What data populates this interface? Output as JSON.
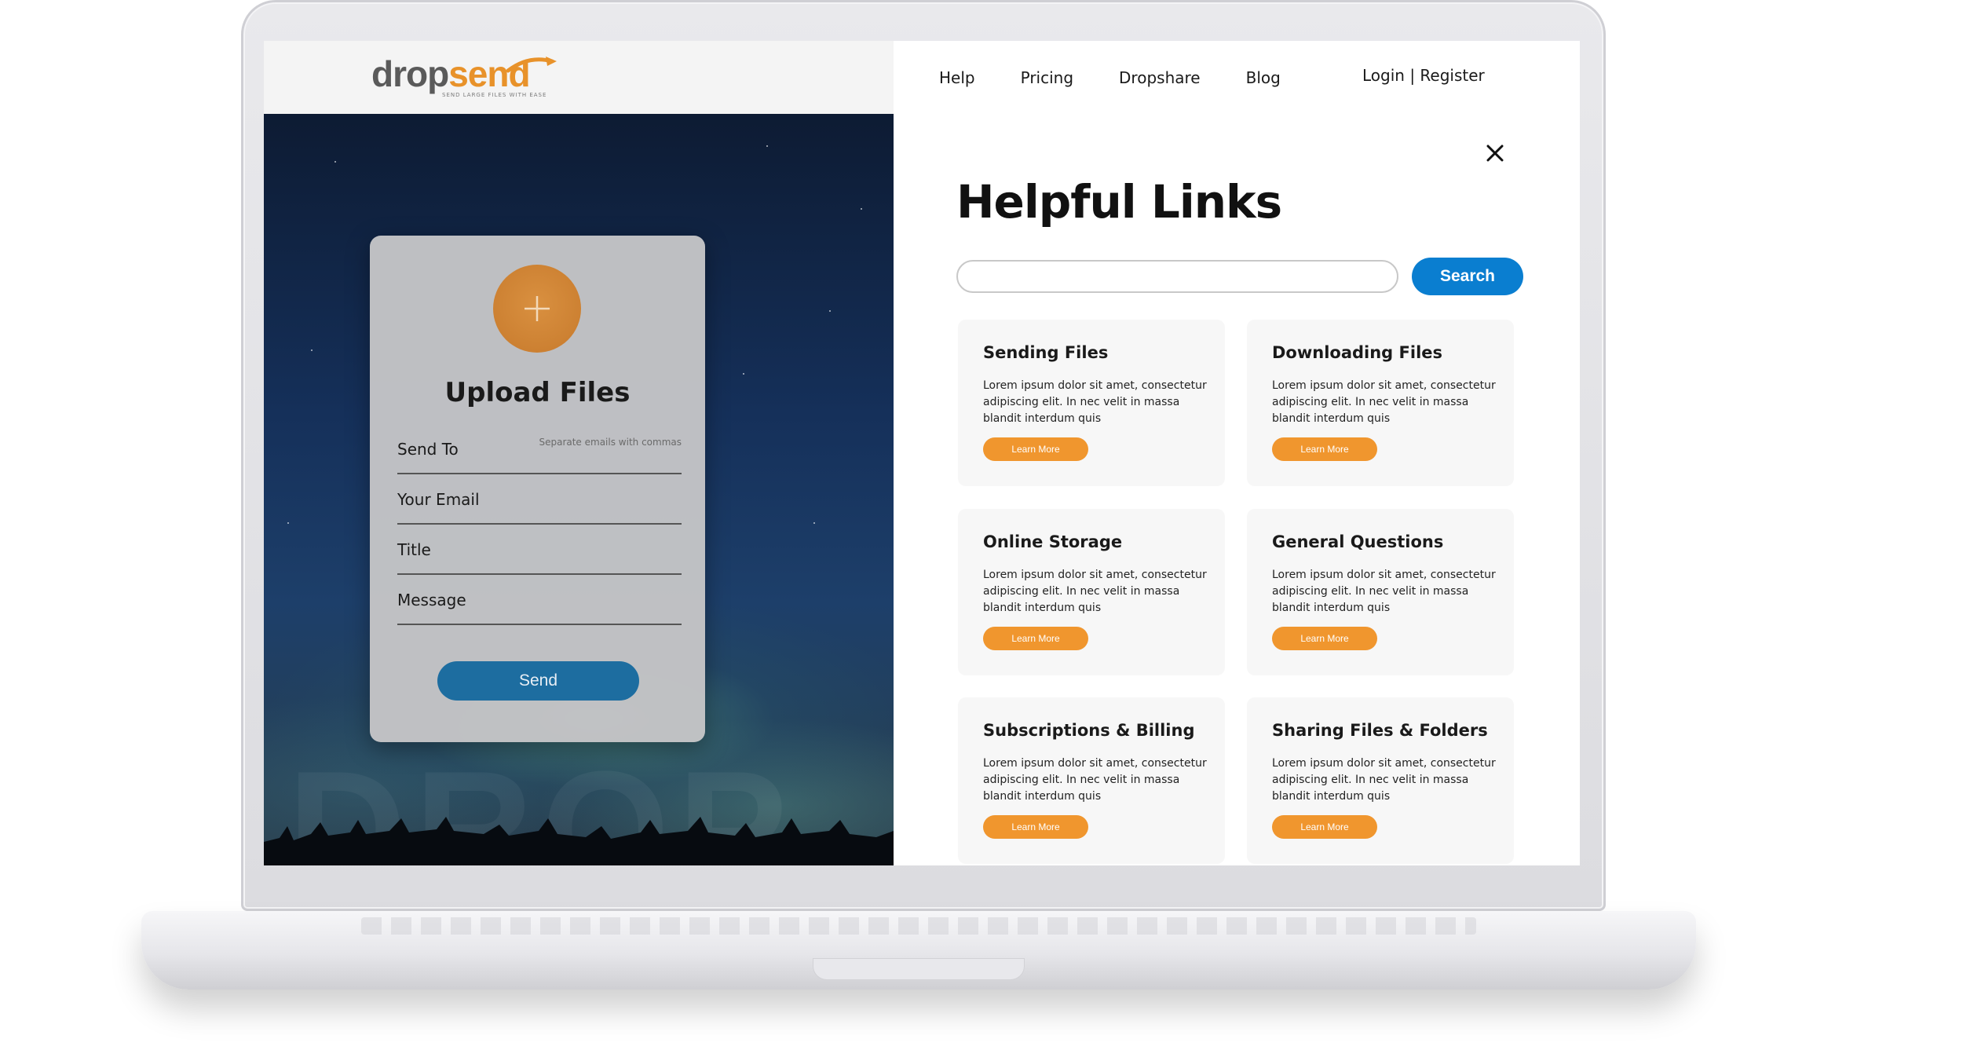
{
  "header": {
    "logo": {
      "drop": "drop",
      "send": "send",
      "tagline": "SEND LARGE FILES WITH EASE"
    },
    "nav": [
      {
        "label": "Help"
      },
      {
        "label": "Pricing"
      },
      {
        "label": "Dropshare"
      },
      {
        "label": "Blog"
      }
    ],
    "auth_label": "Login | Register"
  },
  "upload": {
    "plus_icon": "plus-icon",
    "title": "Upload Files",
    "fields": [
      {
        "label": "Send To",
        "hint": "Separate emails with commas"
      },
      {
        "label": "Your Email"
      },
      {
        "label": "Title"
      },
      {
        "label": "Message"
      }
    ],
    "send_label": "Send"
  },
  "hero": {
    "watermark": "DROP"
  },
  "help": {
    "title": "Helpful Links",
    "search_placeholder": "",
    "search_label": "Search",
    "close_icon": "close-icon",
    "cards": [
      {
        "title": "Sending Files",
        "body": "Lorem ipsum dolor sit amet, consectetur adipiscing elit. In nec velit in massa blandit interdum quis",
        "button": "Learn More"
      },
      {
        "title": "Downloading Files",
        "body": "Lorem ipsum dolor sit amet, consectetur adipiscing elit. In nec velit in massa blandit interdum quis",
        "button": "Learn More"
      },
      {
        "title": "Online Storage",
        "body": "Lorem ipsum dolor sit amet, consectetur adipiscing elit. In nec velit in massa blandit interdum quis",
        "button": "Learn More"
      },
      {
        "title": "General Questions",
        "body": "Lorem ipsum dolor sit amet, consectetur adipiscing elit. In nec velit in massa blandit interdum quis",
        "button": "Learn More"
      },
      {
        "title": "Subscriptions & Billing",
        "body": "Lorem ipsum dolor sit amet, consectetur adipiscing elit. In nec velit in massa blandit interdum quis",
        "button": "Learn More"
      },
      {
        "title": "Sharing Files & Folders",
        "body": "Lorem ipsum dolor sit amet, consectetur adipiscing elit. In nec velit in massa blandit interdum quis",
        "button": "Learn More"
      }
    ]
  },
  "colors": {
    "brand_orange": "#e8922a",
    "primary_blue": "#0a7ed0",
    "send_blue": "#1d6da0"
  }
}
